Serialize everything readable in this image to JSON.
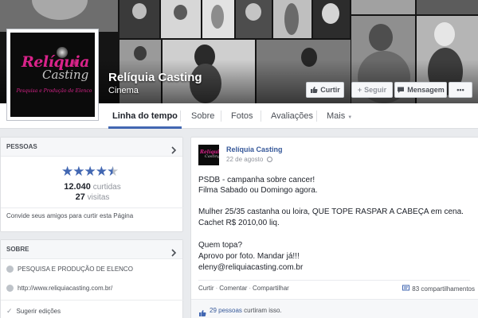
{
  "page": {
    "name": "Relíquia Casting",
    "category": "Cinema",
    "logo_line1": "Relíquia",
    "logo_line2": "Casting",
    "logo_tagline": "Pesquisa e Produção de Elenco"
  },
  "cover_buttons": {
    "like": "Curtir",
    "follow": "Seguir",
    "message": "Mensagem",
    "more": "•••"
  },
  "nav": {
    "tabs": [
      "Linha do tempo",
      "Sobre",
      "Fotos",
      "Avaliações",
      "Mais"
    ]
  },
  "people": {
    "header": "PESSOAS",
    "rating": 4.5,
    "stars": "★★★★★",
    "likes_count": "12.040",
    "likes_label": "curtidas",
    "visits_count": "27",
    "visits_label": "visitas",
    "invite_text": "Convide seus amigos para curtir esta Página"
  },
  "about": {
    "header": "SOBRE",
    "description": "PESQUISA E PRODUÇÃO DE ELENCO",
    "website": "http://www.reliquiacasting.com.br/",
    "suggest_edits": "Sugerir edições"
  },
  "post": {
    "author": "Relíquia Casting",
    "date": "22 de agosto",
    "lines": [
      "PSDB - campanha sobre cancer!",
      "Filma Sabado ou Domingo agora.",
      "Mulher 25/35 castanha ou loira, QUE TOPE RASPAR A CABEÇA em cena.",
      "Cachet R$ 2010,00 liq.",
      "Quem topa?",
      "Aprovo por foto. Mandar já!!!",
      "eleny@reliquiacasting.com.br"
    ],
    "action_like": "Curtir",
    "action_comment": "Comentar",
    "action_share": "Compartilhar",
    "shares": "83 compartilhamentos",
    "likes_people": "29 pessoas",
    "likes_suffix": "curtiram isso."
  },
  "colors": {
    "facebook_blue": "#4267b2",
    "link_blue": "#365899",
    "logo_pink": "#d9238a"
  }
}
